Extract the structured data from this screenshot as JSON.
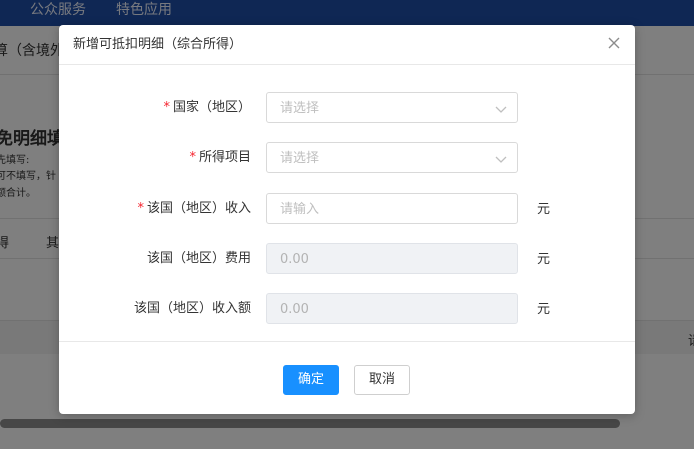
{
  "topnav": {
    "items": [
      "公众服务",
      "特色应用"
    ]
  },
  "background": {
    "fragment_title": "算（含境外",
    "section_title": "免明细填",
    "hint_lines": [
      "先填写:",
      "可不填写，针",
      "额合计。"
    ],
    "col1": "得",
    "col2": "其",
    "right_cell": "请"
  },
  "dialog": {
    "title": "新增可抵扣明细（综合所得）",
    "fields": [
      {
        "label": "国家（地区）",
        "required": true,
        "placeholder": "请选择",
        "type": "select"
      },
      {
        "label": "所得项目",
        "required": true,
        "placeholder": "请选择",
        "type": "select"
      },
      {
        "label": "该国（地区）收入",
        "required": true,
        "placeholder": "请输入",
        "unit": "元",
        "type": "input"
      },
      {
        "label": "该国（地区）费用",
        "required": false,
        "value": "0.00",
        "unit": "元",
        "type": "disabled"
      },
      {
        "label": "该国（地区）收入额",
        "required": false,
        "value": "0.00",
        "unit": "元",
        "type": "disabled"
      }
    ],
    "ok_label": "确定",
    "cancel_label": "取消",
    "required_mark": "*"
  },
  "colors": {
    "primary": "#1890ff",
    "required": "#f5222d",
    "nav": "#1f4ea8"
  }
}
